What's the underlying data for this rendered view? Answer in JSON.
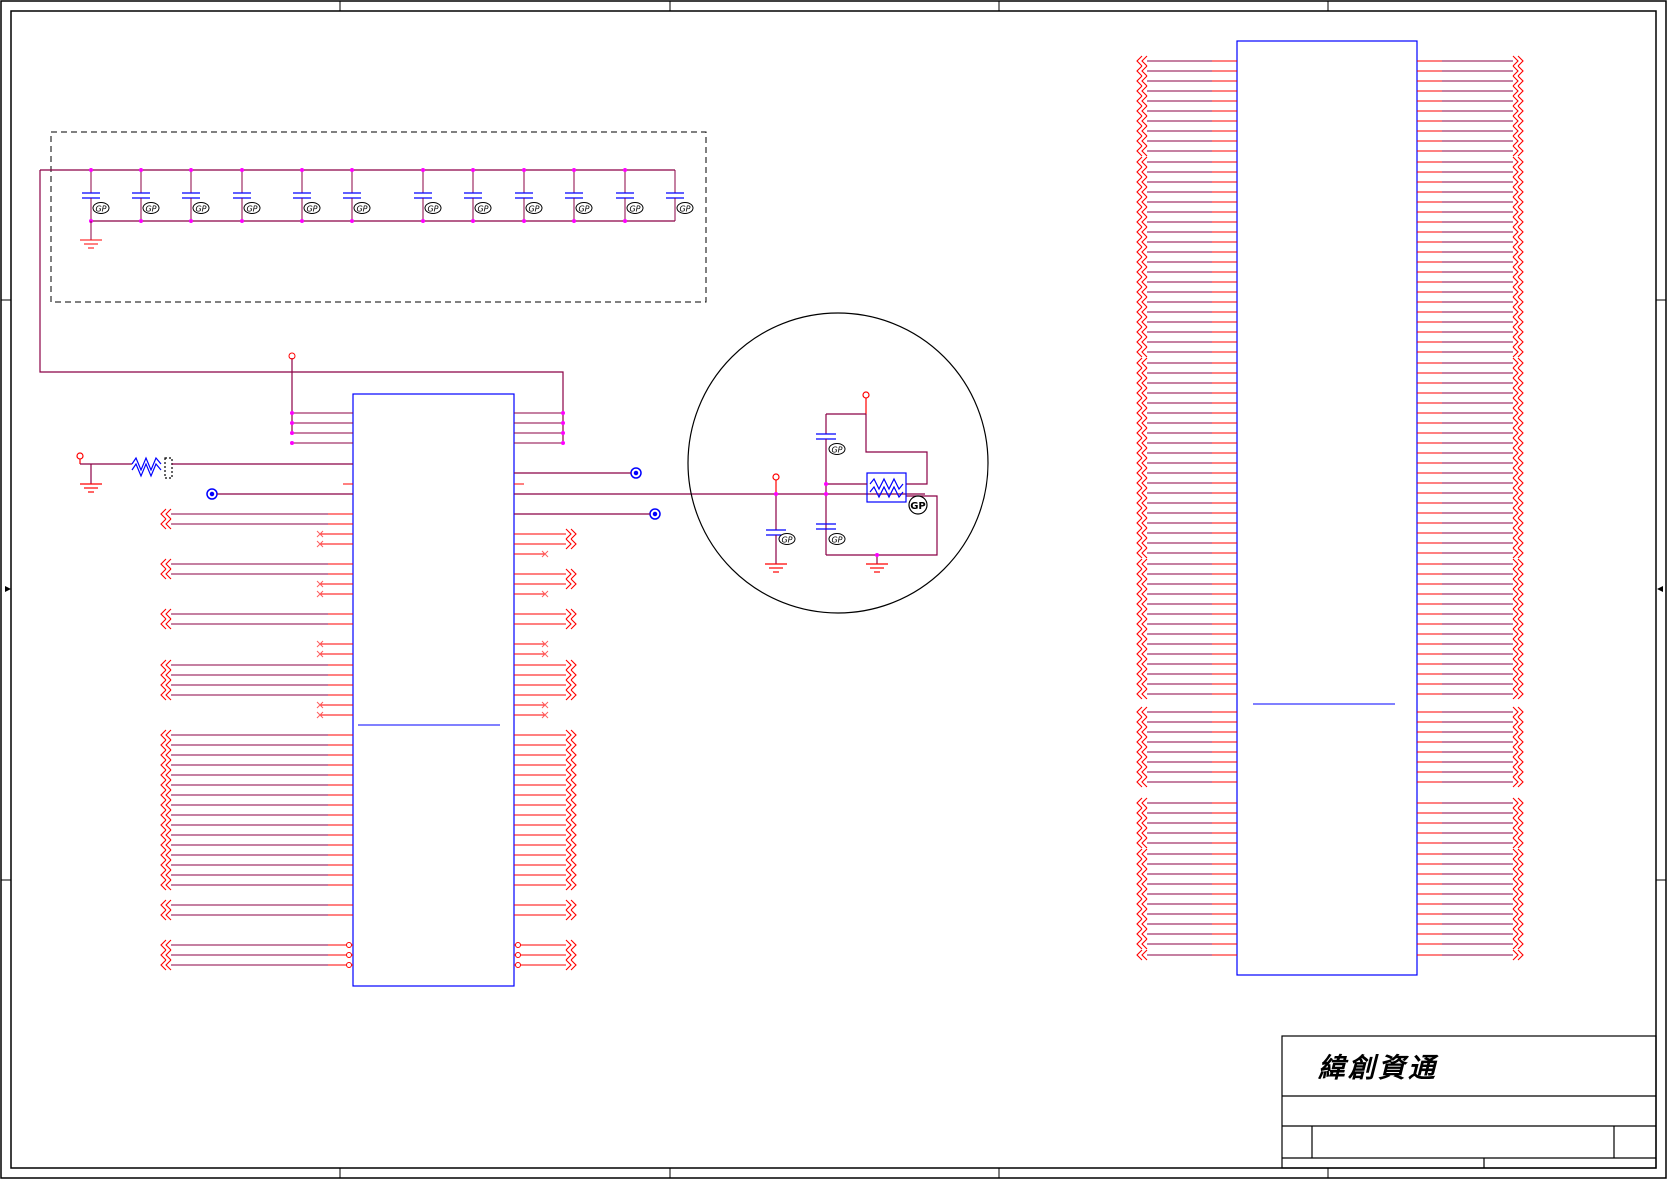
{
  "title_block": {
    "company": "緯創資通"
  },
  "symbols": {
    "gp_label": "GP"
  },
  "colors": {
    "sheet_border": "#000000",
    "wire": "#8b0046",
    "pin": "#ff0000",
    "component_body": "#0000ff",
    "junction": "#ff00ff",
    "background": "#ffffff"
  },
  "counts": {
    "decoupling_capacitors": 12,
    "connector_left_pins": 120,
    "connector_right_pins": 120
  }
}
